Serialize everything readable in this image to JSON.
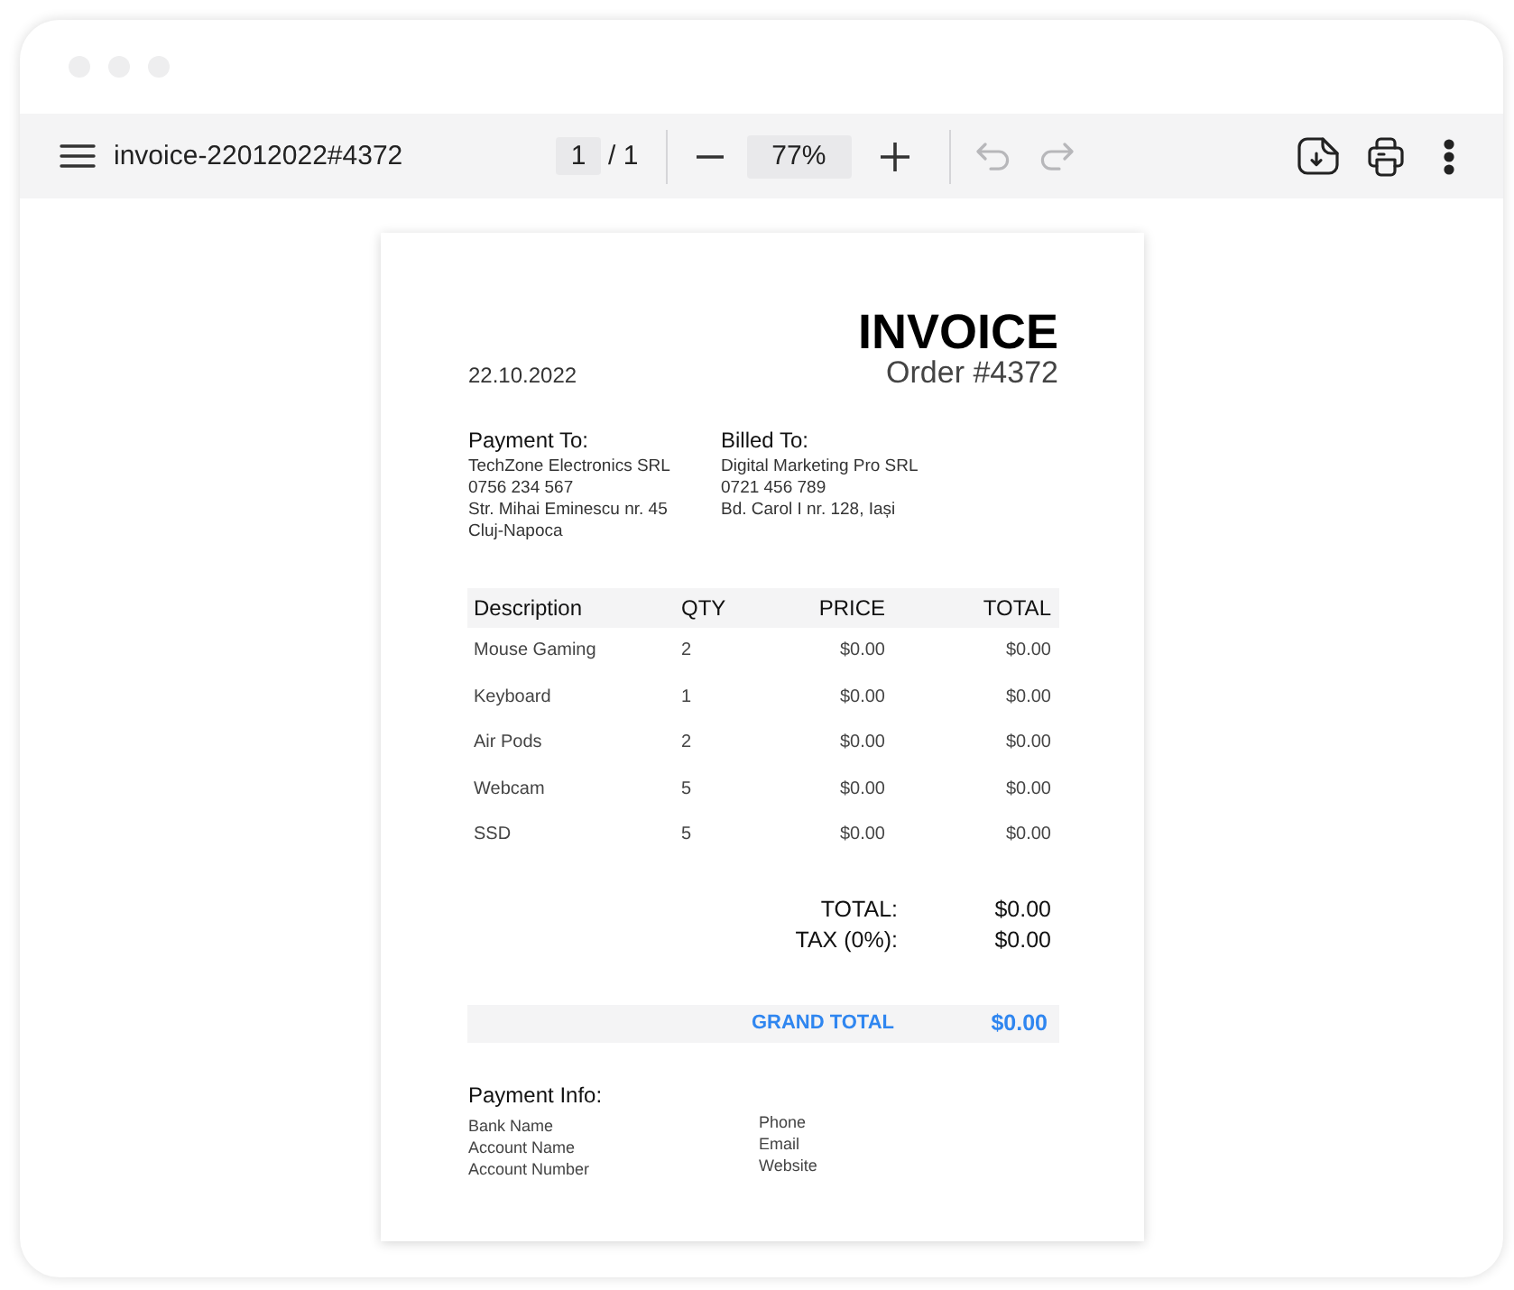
{
  "toolbar": {
    "file_name": "invoice-22012022#4372",
    "page_field": {
      "value": "1"
    },
    "page_count": "/ 1",
    "zoom_field": {
      "value": "77%"
    },
    "history": [
      {
        "kind": "undo",
        "disabled": true
      },
      {
        "kind": "redo",
        "disabled": true
      }
    ]
  },
  "document": {
    "title": "INVOICE",
    "order": "Order #4372",
    "date": "22.10.2022",
    "parties": [
      {
        "heading": "Payment To:",
        "lines": [
          "TechZone Electronics SRL",
          "0756 234 567",
          "Str. Mihai Eminescu nr. 45",
          "Cluj-Napoca"
        ]
      },
      {
        "heading": "Billed To:",
        "lines": [
          "Digital Marketing Pro SRL",
          "0721 456 789",
          "Bd. Carol I nr. 128, Iași"
        ]
      }
    ],
    "table": {
      "columns": [
        "Description",
        "QTY",
        "PRICE",
        "TOTAL"
      ],
      "rows": [
        [
          "Mouse Gaming",
          "2",
          "$0.00",
          "$0.00"
        ],
        [
          "Keyboard",
          "1",
          "$0.00",
          "$0.00"
        ],
        [
          "Air Pods",
          "2",
          "$0.00",
          "$0.00"
        ],
        [
          "Webcam",
          "5",
          "$0.00",
          "$0.00"
        ],
        [
          "SSD",
          "5",
          "$0.00",
          "$0.00"
        ]
      ]
    },
    "summary": [
      {
        "label": "TOTAL:",
        "value": "$0.00"
      },
      {
        "label": "TAX (0%):",
        "value": "$0.00"
      }
    ],
    "grand_total": {
      "label": "GRAND TOTAL",
      "value": "$0.00"
    },
    "payment_info": {
      "heading": "Payment Info:",
      "columns": [
        [
          "Bank Name",
          "Account Name",
          "Account Number"
        ],
        [
          "Phone",
          "Email",
          "Website"
        ]
      ]
    }
  }
}
